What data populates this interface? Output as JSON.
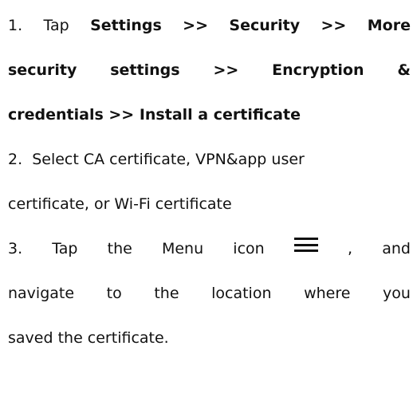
{
  "step1": {
    "num": "1.",
    "tap": "Tap",
    "settings": "Settings",
    "sep1": ">>",
    "security": "Security",
    "sep2": ">>",
    "more": "More",
    "security2": "security",
    "settings2": "settings",
    "sep3": ">>",
    "encryption": "Encryption",
    "amp": "&",
    "credentials": "credentials >> Install a certificate"
  },
  "step2": {
    "line1": "2.  Select CA certificate, VPN&app user",
    "line2": "certificate, or Wi-Fi certificate"
  },
  "step3": {
    "num": "3.",
    "tap": "Tap",
    "the": "the",
    "menu": "Menu",
    "icon": "icon",
    "comma": ",",
    "and": "and",
    "icon_name": "menu-icon",
    "w_navigate": "navigate",
    "w_to": "to",
    "w_the": "the",
    "w_location": "location",
    "w_where": "where",
    "w_you": "you",
    "line3": "saved the certificate."
  }
}
